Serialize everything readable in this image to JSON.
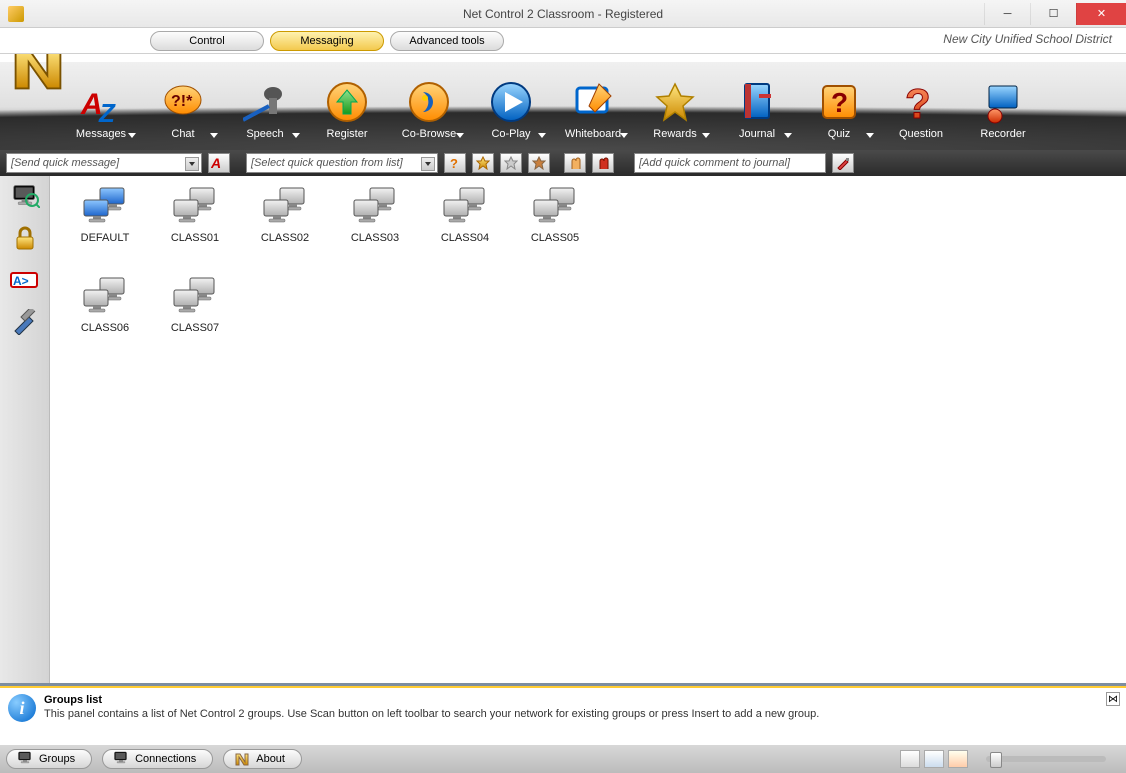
{
  "window": {
    "title": "Net Control 2 Classroom - Registered"
  },
  "tabs": {
    "control": "Control",
    "messaging": "Messaging",
    "advanced": "Advanced tools",
    "active": "messaging"
  },
  "org": "New City Unified School District",
  "ribbon": [
    {
      "id": "messages",
      "label": "Messages",
      "drop": true
    },
    {
      "id": "chat",
      "label": "Chat",
      "drop": true
    },
    {
      "id": "speech",
      "label": "Speech",
      "drop": true
    },
    {
      "id": "register",
      "label": "Register",
      "drop": false
    },
    {
      "id": "cobrowse",
      "label": "Co-Browse",
      "drop": true
    },
    {
      "id": "coplay",
      "label": "Co-Play",
      "drop": true
    },
    {
      "id": "whiteboard",
      "label": "Whiteboard",
      "drop": true
    },
    {
      "id": "rewards",
      "label": "Rewards",
      "drop": true
    },
    {
      "id": "journal",
      "label": "Journal",
      "drop": true
    },
    {
      "id": "quiz",
      "label": "Quiz",
      "drop": true
    },
    {
      "id": "question",
      "label": "Question",
      "drop": false
    },
    {
      "id": "recorder",
      "label": "Recorder",
      "drop": false
    }
  ],
  "quick": {
    "msg_placeholder": "[Send quick message]",
    "question_placeholder": "[Select quick question from list]",
    "journal_placeholder": "[Add quick comment to journal]"
  },
  "groups": [
    {
      "name": "DEFAULT",
      "selected": true
    },
    {
      "name": "CLASS01",
      "selected": false
    },
    {
      "name": "CLASS02",
      "selected": false
    },
    {
      "name": "CLASS03",
      "selected": false
    },
    {
      "name": "CLASS04",
      "selected": false
    },
    {
      "name": "CLASS05",
      "selected": false
    },
    {
      "name": "CLASS06",
      "selected": false
    },
    {
      "name": "CLASS07",
      "selected": false
    }
  ],
  "info": {
    "title": "Groups list",
    "body": "This panel contains a list of Net Control 2 groups. Use Scan button on left toolbar to search your network for existing groups or press Insert to add a new group."
  },
  "bottom": {
    "groups": "Groups",
    "connections": "Connections",
    "about": "About"
  }
}
